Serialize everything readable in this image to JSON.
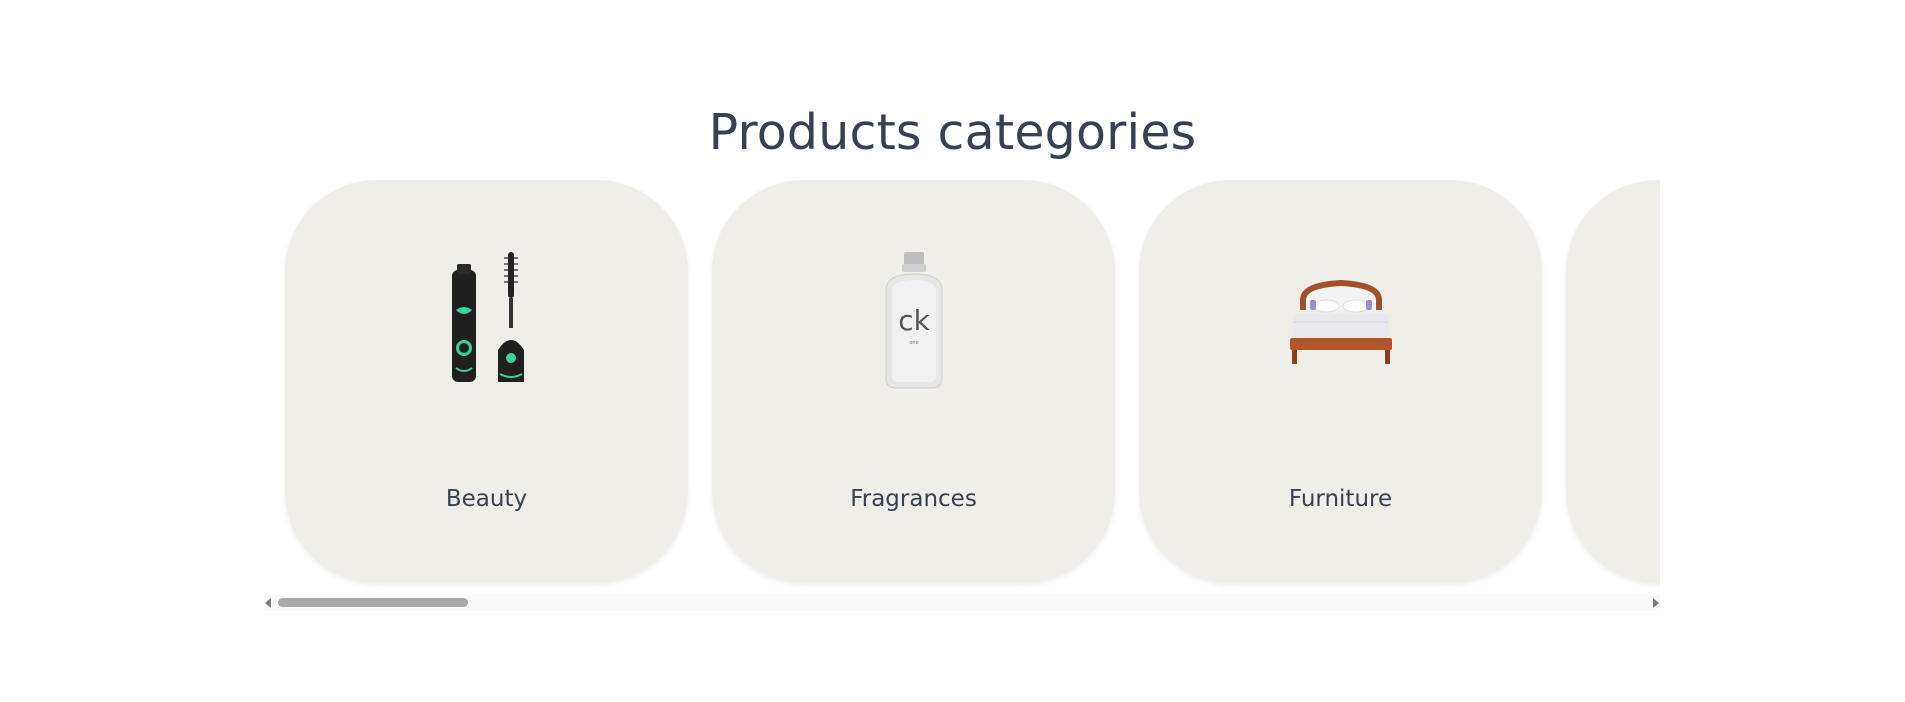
{
  "section": {
    "title": "Products categories"
  },
  "categories": [
    {
      "label": "Beauty",
      "icon": "mascara-icon"
    },
    {
      "label": "Fragrances",
      "icon": "perfume-bottle-icon"
    },
    {
      "label": "Furniture",
      "icon": "bed-icon"
    },
    {
      "label": "",
      "icon": ""
    }
  ],
  "colors": {
    "card_bg": "#efeee8",
    "text": "#374151",
    "scroll_thumb": "#a9a9a9"
  }
}
